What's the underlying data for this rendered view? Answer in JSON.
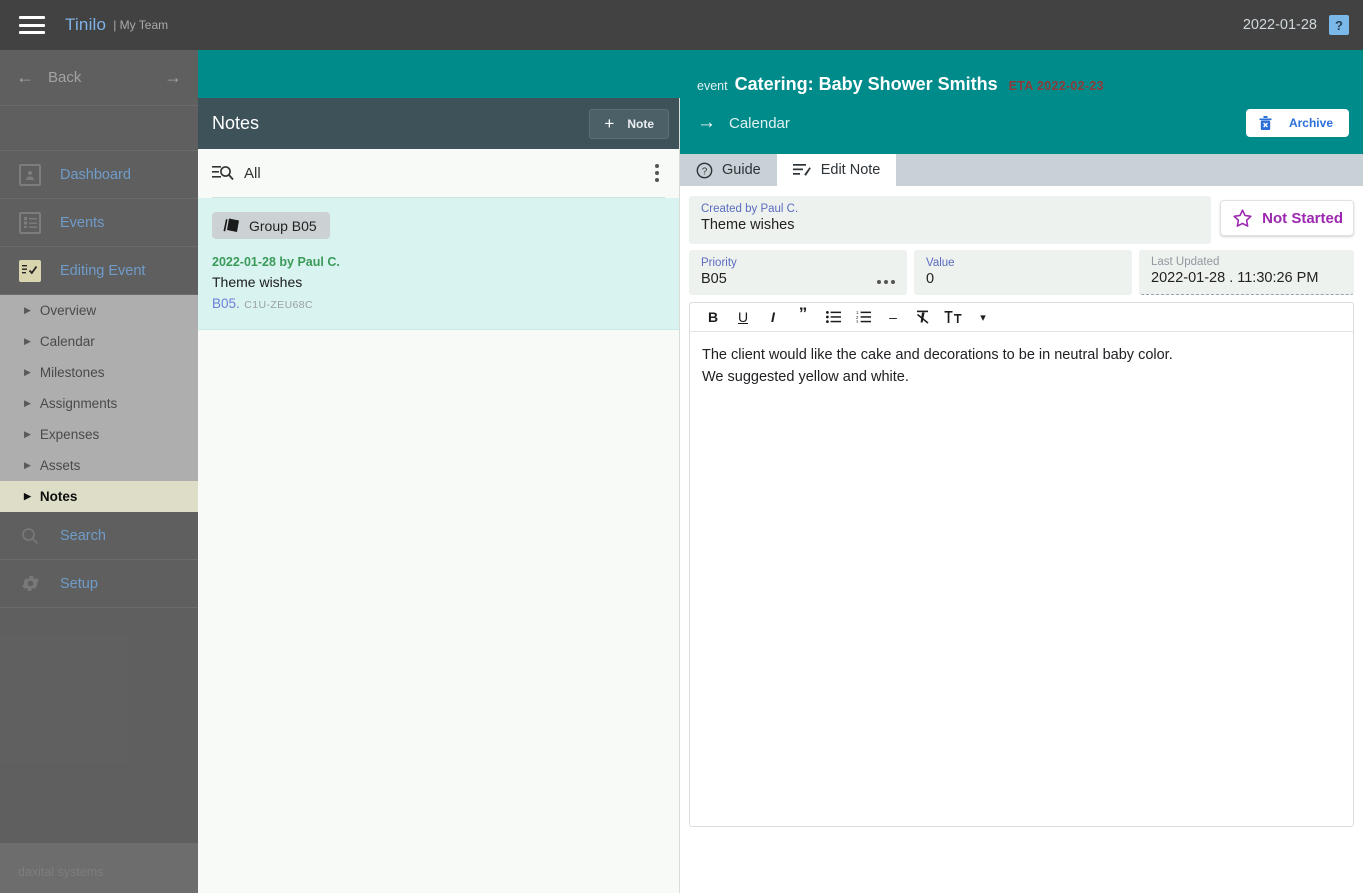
{
  "topbar": {
    "menu_icon": "hamburger-icon",
    "brand": "Tinilo",
    "team": "| My Team",
    "date": "2022-01-28",
    "help_label": "?"
  },
  "sidebar": {
    "back_label": "Back",
    "main_items": [
      {
        "label": "Dashboard",
        "icon": "user-card-icon"
      },
      {
        "label": "Events",
        "icon": "list-box-icon"
      },
      {
        "label": "Editing Event",
        "icon": "edit-checklist-icon"
      }
    ],
    "sub_items": [
      {
        "label": "Overview"
      },
      {
        "label": "Calendar"
      },
      {
        "label": "Milestones"
      },
      {
        "label": "Assignments"
      },
      {
        "label": "Expenses"
      },
      {
        "label": "Assets"
      },
      {
        "label": "Notes"
      }
    ],
    "tail_items": [
      {
        "label": "Search",
        "icon": "magnifier-icon"
      },
      {
        "label": "Setup",
        "icon": "gear-icon"
      }
    ],
    "footer": "daxital systems"
  },
  "notes_panel": {
    "title": "Notes",
    "add_button": {
      "plus": "+",
      "label": "Note"
    },
    "filter": {
      "icon": "filter-search-icon",
      "text": "All"
    },
    "items": [
      {
        "group_chip": "Group B05",
        "meta": "2022-01-28 by Paul C.",
        "title": "Theme wishes",
        "code": "B05",
        "separator": ".",
        "uid": "C1U-ZEU68C"
      }
    ]
  },
  "event_header": {
    "kicker": "event",
    "title": "Catering: Baby Shower Smiths",
    "eta": "ETA 2022-02-23",
    "nav_label": "Calendar",
    "archive_label": "Archive"
  },
  "tabs": [
    {
      "label": "Guide",
      "icon": "question-circle-icon",
      "active": false
    },
    {
      "label": "Edit Note",
      "icon": "note-edit-icon",
      "active": true
    }
  ],
  "note_detail": {
    "created_by_label": "Created by Paul C.",
    "title_value": "Theme wishes",
    "status_label": "Not Started",
    "priority_label": "Priority",
    "priority_value": "B05",
    "value_label": "Value",
    "value_value": "0",
    "updated_label": "Last Updated",
    "updated_value": "2022-01-28 . 11:30:26 PM"
  },
  "editor": {
    "toolbar": [
      {
        "name": "bold-button",
        "glyph": "B"
      },
      {
        "name": "underline-button",
        "glyph": "U"
      },
      {
        "name": "italic-button",
        "glyph": "I"
      },
      {
        "name": "quote-button",
        "glyph": "”"
      },
      {
        "name": "bullet-list-button",
        "glyph": ""
      },
      {
        "name": "numbered-list-button",
        "glyph": ""
      },
      {
        "name": "horizontal-rule-button",
        "glyph": "–"
      },
      {
        "name": "clear-format-button",
        "glyph": ""
      },
      {
        "name": "font-size-button",
        "glyph": ""
      },
      {
        "name": "more-dropdown-button",
        "glyph": "▾"
      }
    ],
    "lines": [
      "The client would like the cake and decorations to be in neutral baby color.",
      "We suggested yellow and white."
    ]
  },
  "colors": {
    "teal": "#008b8b",
    "topbar": "#424242",
    "sidebar": "#6d6d6d",
    "notes_header": "#3d5259",
    "note_selected": "#d9f3f0",
    "accent_blue": "#7fb2e5",
    "status_purple": "#9c27b0",
    "eta_red": "#8e3a3a",
    "meta_green": "#3a9b59",
    "label_blue": "#5b6bc0"
  }
}
